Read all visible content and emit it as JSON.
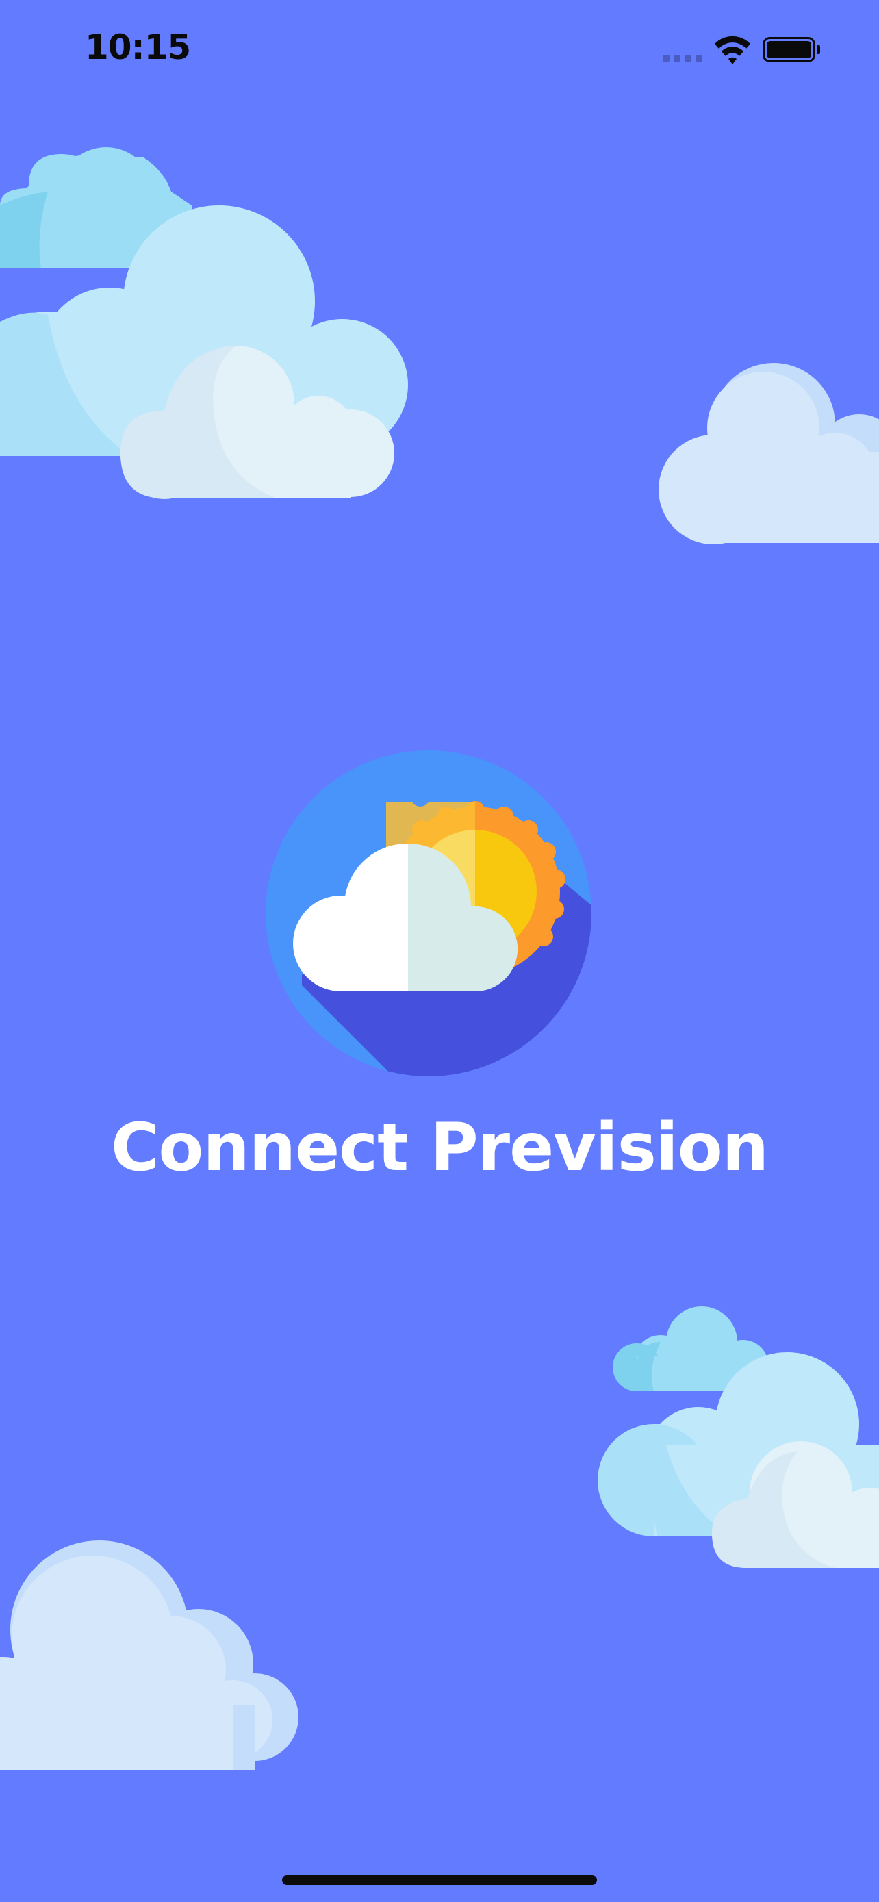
{
  "status_bar": {
    "time": "10:15",
    "signal_icon": "cellular-signal-icon",
    "wifi_icon": "wifi-icon",
    "battery_icon": "battery-icon"
  },
  "splash": {
    "app_name": "Connect Prevision",
    "logo_icon": "sun-behind-cloud-icon",
    "background_color": "#637BFE"
  },
  "decor": {
    "cloud_icon": "cloud-icon"
  }
}
